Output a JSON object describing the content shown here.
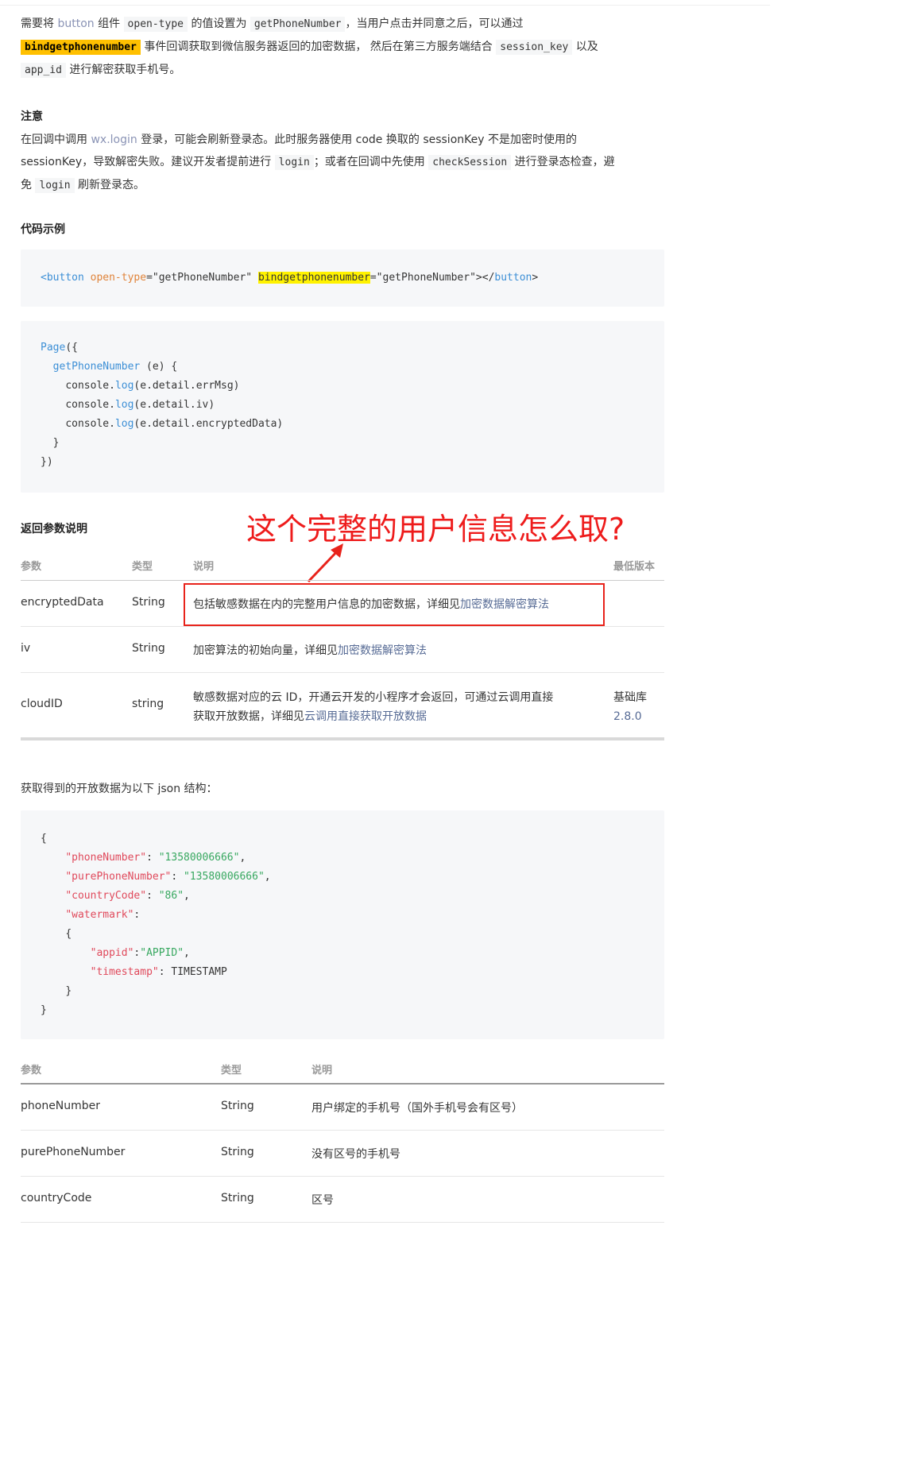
{
  "intro": {
    "p1": "需要将",
    "p1_link": "button",
    "p2": "组件",
    "open_type": "open-type",
    "p3": "的值设置为",
    "getphonenumber": "getPhoneNumber",
    "p4": "，当用户点击并同意之后，可以通过",
    "bind": "bindgetphonenumber",
    "p5": "事件回调获取到微信服务器返回的加密数据， 然后在第三方服务端结合",
    "session_key": "session_key",
    "p6": "以及",
    "app_id": "app_id",
    "p7": "进行解密获取手机号。"
  },
  "notice": {
    "title": "注意",
    "t1": "在回调中调用",
    "wxlogin": "wx.login",
    "t2": "登录，可能会刷新登录态。此时服务器使用 code 换取的 sessionKey 不是加密时使用的",
    "t3": "sessionKey，导致解密失败。建议开发者提前进行",
    "login": "login",
    "t4": "；或者在回调中先使用",
    "checksession": "checkSession",
    "t5": "进行登录态检查，避",
    "t6": "免",
    "login2": "login",
    "t7": "刷新登录态。"
  },
  "code_example": {
    "title": "代码示例",
    "b_open": "<button",
    "b_attr": "open-type",
    "b_val": "=\"getPhoneNumber\"",
    "b_bind": "bindgetphonenumber",
    "b_val2": "=\"getPhoneNumber\"></",
    "b_close_tag": "button",
    "b_end": ">",
    "page_lines": {
      "l1a": "Page",
      "l1b": "({",
      "l2a": "getPhoneNumber",
      "l2b": " (e) {",
      "l3a": "console.",
      "l3b": "log",
      "l3c": "(e.detail.errMsg)",
      "l4a": "console.",
      "l4b": "log",
      "l4c": "(e.detail.iv)",
      "l5a": "console.",
      "l5b": "log",
      "l5c": "(e.detail.encryptedData)",
      "l6": "}",
      "l7": "})"
    }
  },
  "return_params": {
    "title": "返回参数说明",
    "annotation": "这个完整的用户信息怎么取?",
    "headers": [
      "参数",
      "类型",
      "说明",
      "最低版本"
    ],
    "rows": [
      {
        "name": "encryptedData",
        "type": "String",
        "desc": "包括敏感数据在内的完整用户信息的加密数据，详细见",
        "link": "加密数据解密算法",
        "version": ""
      },
      {
        "name": "iv",
        "type": "String",
        "desc": "加密算法的初始向量，详细见",
        "link": "加密数据解密算法",
        "version": ""
      },
      {
        "name": "cloudID",
        "type": "string",
        "desc1": "敏感数据对应的云 ID，开通云开发的小程序才会返回，可通过云调用直接",
        "desc2": "获取开放数据，详细见",
        "link": "云调用直接获取开放数据",
        "version1": "基础库",
        "version2": "2.8.0"
      }
    ]
  },
  "json_section": {
    "intro": "获取得到的开放数据为以下 json 结构：",
    "lines": {
      "open": "{",
      "k1": "\"phoneNumber\"",
      "v1": "\"13580006666\"",
      "k2": "\"purePhoneNumber\"",
      "v2": "\"13580006666\"",
      "k3": "\"countryCode\"",
      "v3": "\"86\"",
      "k4": "\"watermark\"",
      "inner_open": "{",
      "k5": "\"appid\"",
      "v5": "\"APPID\"",
      "k6": "\"timestamp\"",
      "v6": "TIMESTAMP",
      "inner_close": "}",
      "close": "}"
    }
  },
  "fields_table": {
    "headers": [
      "参数",
      "类型",
      "说明"
    ],
    "rows": [
      {
        "name": "phoneNumber",
        "type": "String",
        "desc": "用户绑定的手机号（国外手机号会有区号）"
      },
      {
        "name": "purePhoneNumber",
        "type": "String",
        "desc": "没有区号的手机号"
      },
      {
        "name": "countryCode",
        "type": "String",
        "desc": "区号"
      }
    ]
  }
}
